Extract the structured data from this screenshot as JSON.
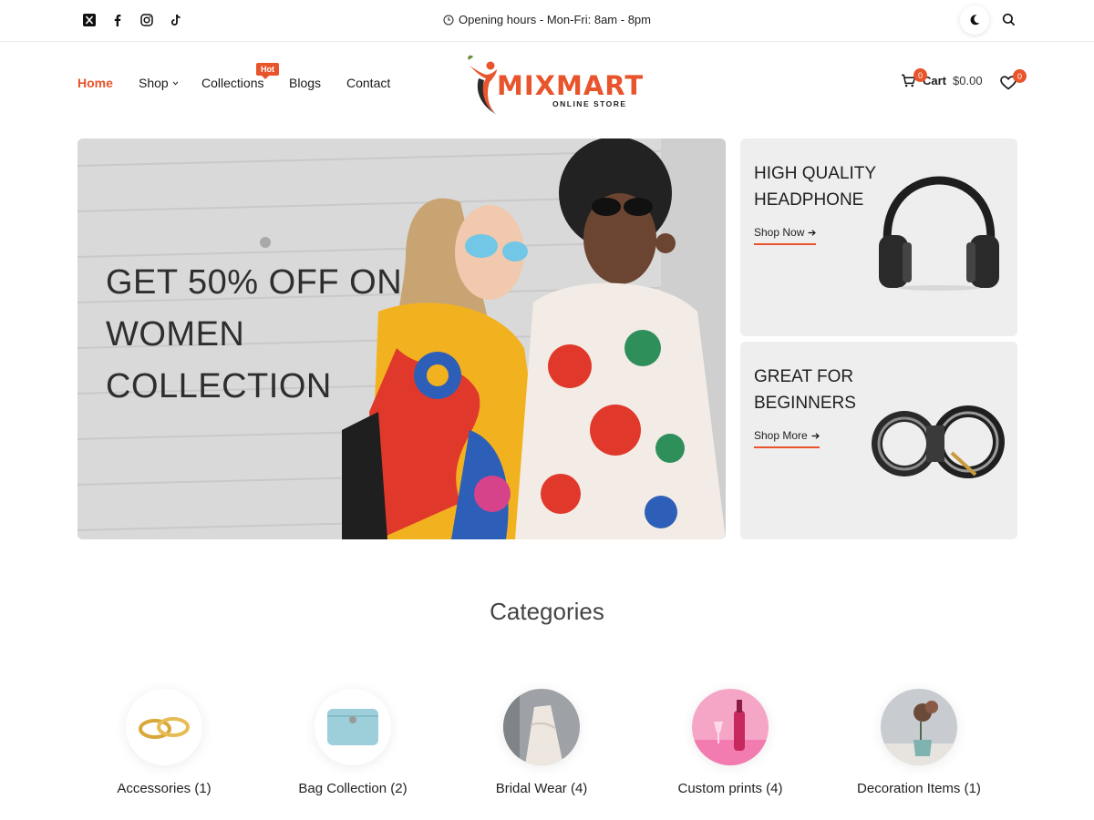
{
  "topbar": {
    "social": [
      "x-icon",
      "facebook-icon",
      "instagram-icon",
      "tiktok-icon"
    ],
    "hours": "Opening hours - Mon-Fri: 8am - 8pm"
  },
  "nav": {
    "home": "Home",
    "shop": "Shop",
    "collections": "Collections",
    "collections_badge": "Hot",
    "blogs": "Blogs",
    "contact": "Contact"
  },
  "logo": {
    "name": "MIXMART",
    "tagline": "ONLINE STORE"
  },
  "cart": {
    "label": "Cart",
    "amount": "$0.00",
    "count": "0"
  },
  "wishlist": {
    "count": "0"
  },
  "hero": {
    "title": "GET 50% OFF ON WOMEN COLLECTION"
  },
  "promos": [
    {
      "title": "HIGH QUALITY HEADPHONE",
      "link": "Shop Now"
    },
    {
      "title": "GREAT FOR BEGINNERS",
      "link": "Shop More"
    }
  ],
  "categories": {
    "heading": "Categories",
    "items": [
      {
        "label": "Accessories (1)"
      },
      {
        "label": "Bag Collection (2)"
      },
      {
        "label": "Bridal Wear (4)"
      },
      {
        "label": "Custom prints (4)"
      },
      {
        "label": "Decoration Items (1)"
      }
    ]
  },
  "colors": {
    "accent": "#e8542b",
    "card_bg": "#eeeeee"
  }
}
